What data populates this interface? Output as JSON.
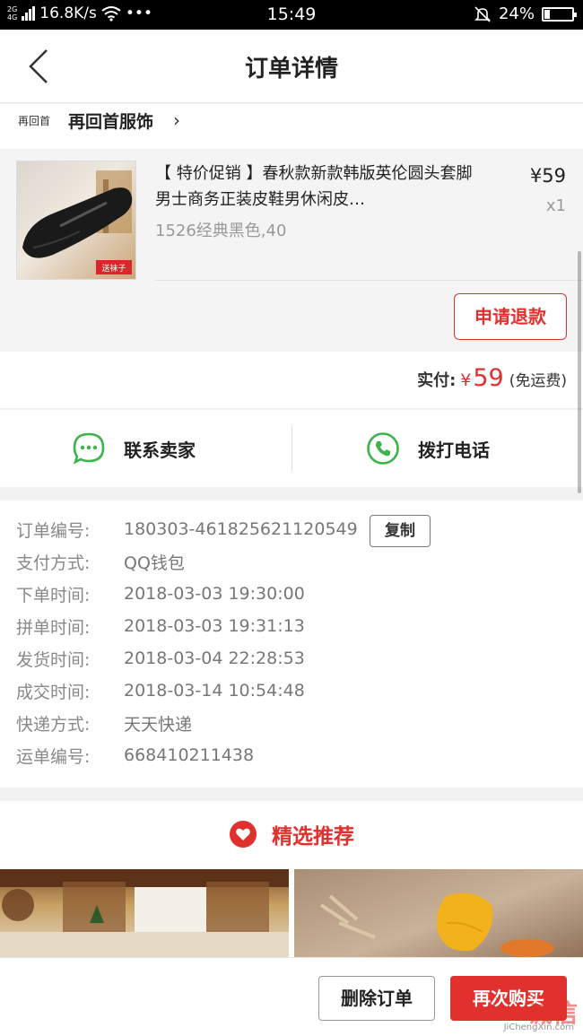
{
  "status_bar": {
    "network_top": "2G",
    "network_bottom": "4G",
    "speed": "16.8K/s",
    "more": "•••",
    "time": "15:49",
    "battery": "24%"
  },
  "nav": {
    "title": "订单详情"
  },
  "shop": {
    "badge": "再回首",
    "name": "再回首服饰",
    "chevron": "›"
  },
  "product": {
    "title": "【 特价促销 】春秋款新款韩版英伦圆头套脚男士商务正装皮鞋男休闲皮…",
    "spec": "1526经典黑色,40",
    "price": "¥59",
    "qty": "x1",
    "image_tag": "送袜子",
    "refund_label": "申请退款"
  },
  "payment": {
    "label": "实付:",
    "currency": "¥",
    "amount": "59",
    "note": "(免运费)"
  },
  "contact": {
    "seller_label": "联系卖家",
    "phone_label": "拨打电话"
  },
  "details": {
    "copy_label": "复制",
    "rows": [
      {
        "label": "订单编号:",
        "value": "180303-461825621120549"
      },
      {
        "label": "支付方式:",
        "value": "QQ钱包"
      },
      {
        "label": "下单时间:",
        "value": "2018-03-03 19:30:00"
      },
      {
        "label": "拼单时间:",
        "value": "2018-03-03 19:31:13"
      },
      {
        "label": "发货时间:",
        "value": "2018-03-04 22:28:53"
      },
      {
        "label": "成交时间:",
        "value": "2018-03-14 10:54:48"
      },
      {
        "label": "快递方式:",
        "value": "天天快递"
      },
      {
        "label": "运单编号:",
        "value": "668410211438"
      }
    ]
  },
  "recommend": {
    "label": "精选推荐"
  },
  "bottom": {
    "delete_label": "删除订单",
    "rebuy_label": "再次购买"
  },
  "watermark": {
    "text": "诚信",
    "url": "JiChengXin.com"
  },
  "colors": {
    "accent": "#e0312e",
    "wechat_green": "#3bb54a"
  }
}
